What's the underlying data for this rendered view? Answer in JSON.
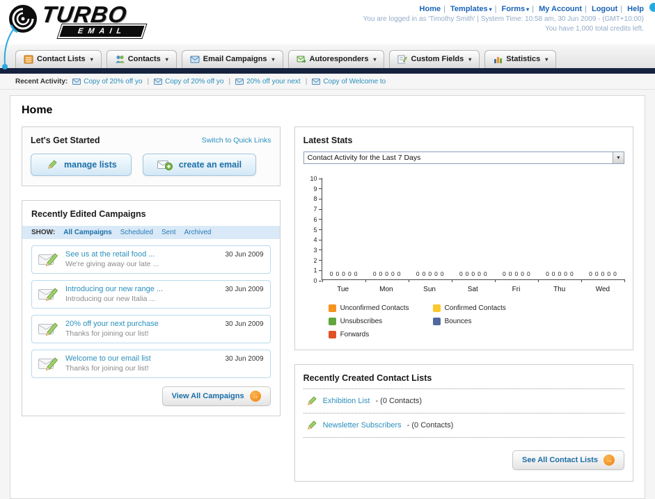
{
  "colors": {
    "link_blue": "#1b64b6",
    "teal_link": "#2a8fbd",
    "navy_bar": "#16233f",
    "orange_accent": "#f6921e",
    "accent_cyan": "#29a8e0"
  },
  "header": {
    "logo_title": "TURBO",
    "logo_subtitle": "EMAIL",
    "links": [
      "Home",
      "Templates",
      "Forms",
      "My Account",
      "Logout",
      "Help"
    ],
    "session_line": "You are logged in as 'Timothy Smith' | System Time: 10:58 am, 30 Jun 2009 - (GMT+10:00)",
    "credits_line": "You have 1,000 total credits left."
  },
  "nav": {
    "tabs": [
      "Contact Lists",
      "Contacts",
      "Email Campaigns",
      "Autoresponders",
      "Custom Fields",
      "Statistics"
    ]
  },
  "recent_activity": {
    "label": "Recent Activity:",
    "items": [
      "Copy of 20% off yo",
      "Copy of 20% off yo",
      "20% off your next",
      "Copy of Welcome to"
    ]
  },
  "page_title": "Home",
  "get_started": {
    "title": "Let's Get Started",
    "switch_link": "Switch to Quick Links",
    "buttons": [
      "manage lists",
      "create an email"
    ]
  },
  "campaigns": {
    "title": "Recently Edited Campaigns",
    "show_label": "SHOW:",
    "filters": [
      "All Campaigns",
      "Scheduled",
      "Sent",
      "Archived"
    ],
    "items": [
      {
        "title": "See us at the retail food ...",
        "subtitle": "We're giving away our late ...",
        "date": "30 Jun 2009"
      },
      {
        "title": "Introducing our new range ...",
        "subtitle": "Introducing our new Italia ...",
        "date": "30 Jun 2009"
      },
      {
        "title": "20% off your next purchase",
        "subtitle": "Thanks for joining our list!",
        "date": "30 Jun 2009"
      },
      {
        "title": "Welcome to our email list",
        "subtitle": "Thanks for joining our list!",
        "date": "30 Jun 2009"
      }
    ],
    "view_all_label": "View All Campaigns"
  },
  "stats": {
    "title": "Latest Stats",
    "dropdown_value": "Contact Activity for the Last 7 Days",
    "chart_data": {
      "type": "bar",
      "title": "Contact Activity for the Last 7 Days",
      "categories": [
        "Tue",
        "Mon",
        "Sun",
        "Sat",
        "Fri",
        "Thu",
        "Wed"
      ],
      "series": [
        {
          "name": "Unconfirmed Contacts",
          "color": "#f6921e",
          "values": [
            0,
            0,
            0,
            0,
            0,
            0,
            0
          ]
        },
        {
          "name": "Confirmed Contacts",
          "color": "#fdc82f",
          "values": [
            0,
            0,
            0,
            0,
            0,
            0,
            0
          ]
        },
        {
          "name": "Unsubscribes",
          "color": "#61a53c",
          "values": [
            0,
            0,
            0,
            0,
            0,
            0,
            0
          ]
        },
        {
          "name": "Bounces",
          "color": "#50699f",
          "values": [
            0,
            0,
            0,
            0,
            0,
            0,
            0
          ]
        },
        {
          "name": "Forwards",
          "color": "#e25126",
          "values": [
            0,
            0,
            0,
            0,
            0,
            0,
            0
          ]
        }
      ],
      "ylim": [
        0,
        10
      ],
      "grid": false,
      "legend_position": "bottom"
    }
  },
  "contact_lists": {
    "title": "Recently Created Contact Lists",
    "items": [
      {
        "name": "Exhibition List",
        "count": "- (0 Contacts)"
      },
      {
        "name": "Newsletter Subscribers",
        "count": "- (0 Contacts)"
      }
    ],
    "see_all_label": "See All Contact Lists"
  }
}
